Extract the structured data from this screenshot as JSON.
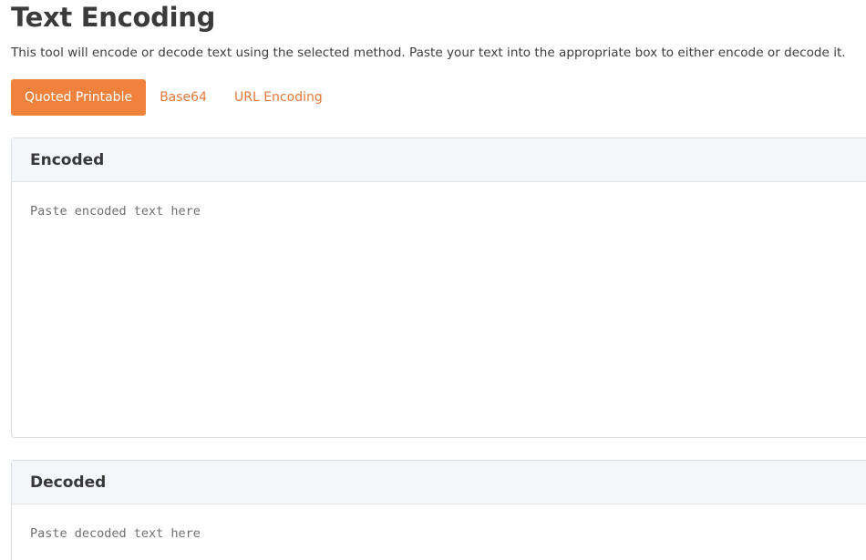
{
  "page": {
    "title": "Text Encoding",
    "description": "This tool will encode or decode text using the selected method. Paste your text into the appropriate box to either encode or decode it."
  },
  "tabs": [
    {
      "label": "Quoted Printable",
      "active": true
    },
    {
      "label": "Base64",
      "active": false
    },
    {
      "label": "URL Encoding",
      "active": false
    }
  ],
  "encoded": {
    "header": "Encoded",
    "value": "",
    "placeholder": "Paste encoded text here"
  },
  "decoded": {
    "header": "Decoded",
    "value": "",
    "placeholder": "Paste decoded text here"
  },
  "colors": {
    "accent": "#f0823e",
    "accent_text": "#e5783a",
    "card_header_bg": "#f4f6f9",
    "border": "#d8dde2"
  }
}
